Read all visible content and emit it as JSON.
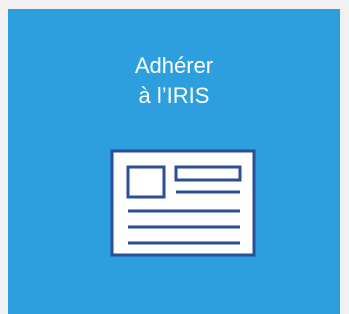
{
  "tile": {
    "title_line1": "Adhérer",
    "title_line2": "à l’IRIS",
    "icon": "membership-card-icon",
    "background": "#2d9fde",
    "icon_fill": "#ffffff",
    "icon_stroke": "#2a4f94"
  }
}
